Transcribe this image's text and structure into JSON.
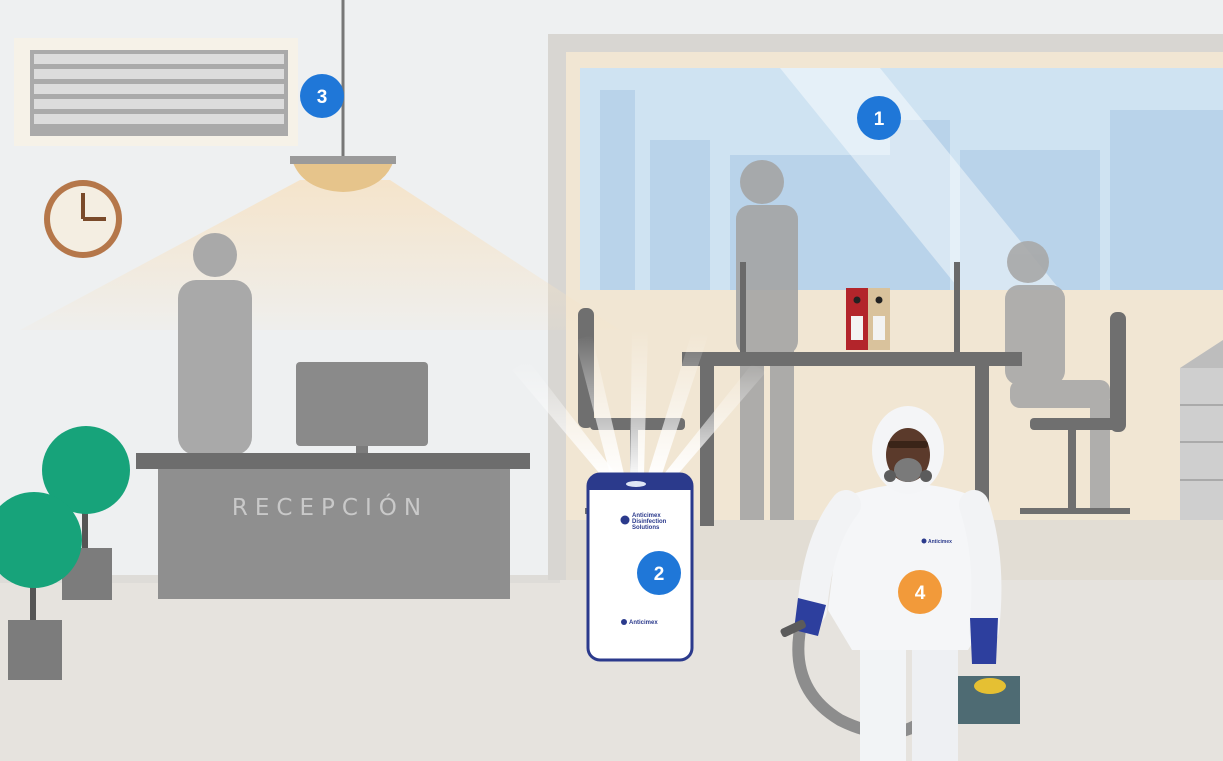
{
  "scene": {
    "reception_sign": "RECEPCIÓN",
    "purifier_brand": [
      "Anticimex",
      "Disinfection",
      "Solutions"
    ],
    "purifier_logo": "Anticimex",
    "suit_logo": "Anticimex"
  },
  "markers": [
    {
      "label": "1",
      "color": "#1f77d8",
      "meaning": "window"
    },
    {
      "label": "2",
      "color": "#1f77d8",
      "meaning": "air-purifier"
    },
    {
      "label": "3",
      "color": "#1f77d8",
      "meaning": "ventilation"
    },
    {
      "label": "4",
      "color": "#f29a3a",
      "meaning": "disinfection-technician"
    }
  ],
  "colors": {
    "wall": "#eef0f1",
    "floor": "#e6e3de",
    "desk": "#8e8e8e",
    "plant": "#17a37a",
    "marker_blue": "#1f77d8",
    "marker_orange": "#f29a3a",
    "purifier_blue": "#2b3a8c",
    "glove_blue": "#2d3f9e"
  }
}
